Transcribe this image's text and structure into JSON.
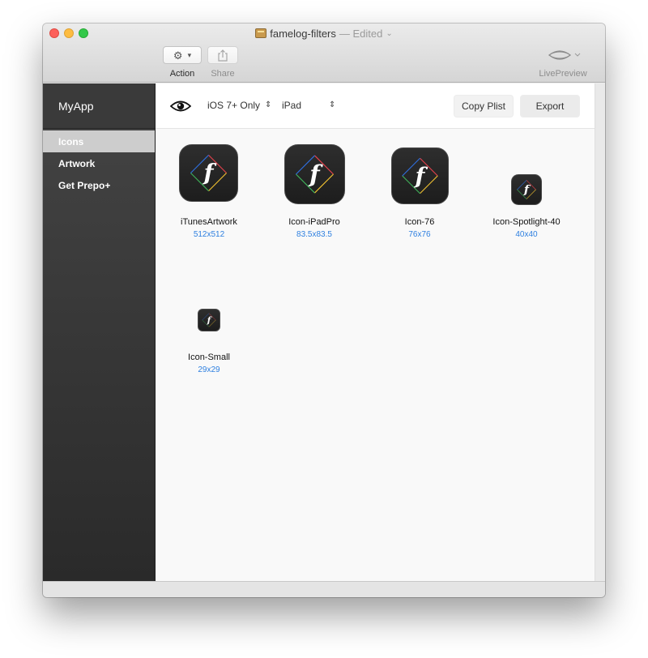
{
  "window": {
    "title": "famelog-filters",
    "title_status": "— Edited",
    "title_chevron": "⌄"
  },
  "toolbar": {
    "action_label": "Action",
    "share_label": "Share",
    "livepreview_label": "LivePreview"
  },
  "sidebar": {
    "app_name": "MyApp",
    "items": [
      {
        "label": "Icons",
        "active": true
      },
      {
        "label": "Artwork",
        "active": false
      },
      {
        "label": "Get Prepo+",
        "active": false
      }
    ]
  },
  "main": {
    "ios_filter": "iOS 7+ Only",
    "device": "iPad",
    "copy_label": "Copy Plist",
    "export_label": "Export",
    "icons": [
      {
        "name": "iTunesArtwork",
        "size": "512x512"
      },
      {
        "name": "Icon-iPadPro",
        "size": "83.5x83.5"
      },
      {
        "name": "Icon-76",
        "size": "76x76"
      },
      {
        "name": "Icon-Spotlight-40",
        "size": "40x40"
      },
      {
        "name": "Icon-Small",
        "size": "29x29"
      }
    ]
  },
  "icon_glyph": "f",
  "colors": {
    "accent": "#2f80e0",
    "sidebar_bg": "#333333",
    "sidebar_active": "#cdcdcd",
    "close": "#fc605b",
    "minimize": "#fdbc40",
    "maximize": "#34c84a"
  }
}
